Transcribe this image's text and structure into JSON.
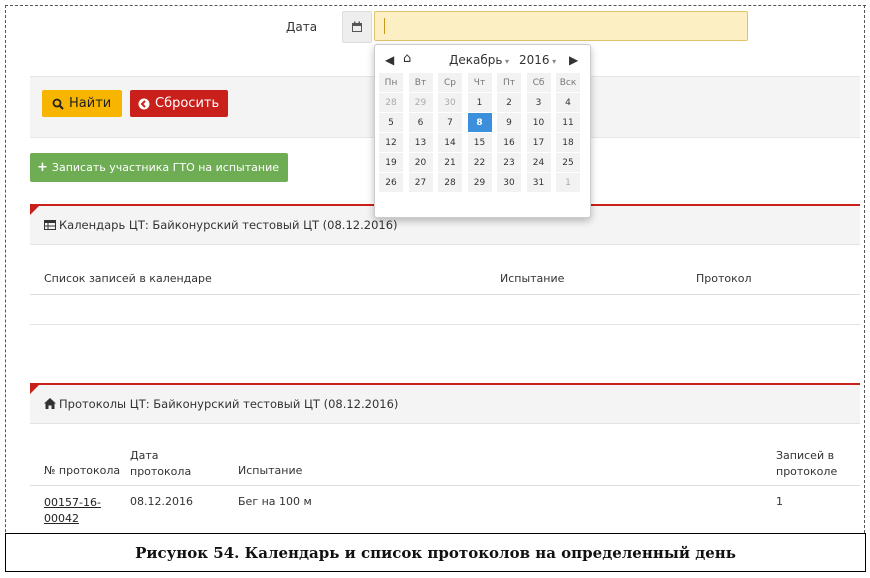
{
  "form": {
    "date_label": "Дата",
    "date_value": ""
  },
  "buttons": {
    "find": "Найти",
    "reset": "Сбросить",
    "add_participant": "Записать участника ГТО на испытание"
  },
  "datepicker": {
    "month": "Декабрь",
    "year": "2016",
    "weekdays": [
      "Пн",
      "Вт",
      "Ср",
      "Чт",
      "Пт",
      "Сб",
      "Вск"
    ],
    "weeks": [
      [
        "28",
        "29",
        "30",
        "1",
        "2",
        "3",
        "4"
      ],
      [
        "5",
        "6",
        "7",
        "8",
        "9",
        "10",
        "11"
      ],
      [
        "12",
        "13",
        "14",
        "15",
        "16",
        "17",
        "18"
      ],
      [
        "19",
        "20",
        "21",
        "22",
        "23",
        "24",
        "25"
      ],
      [
        "26",
        "27",
        "28",
        "29",
        "30",
        "31",
        "1"
      ]
    ],
    "selected": "8"
  },
  "calendar_panel": {
    "title": "Календарь ЦТ: Байконурский тестовый ЦТ (08.12.2016)",
    "columns": [
      "Список записей в календаре",
      "Испытание",
      "Протокол"
    ]
  },
  "protocols_panel": {
    "title": "Протоколы ЦТ: Байконурский тестовый ЦТ (08.12.2016)",
    "columns": {
      "number": "№ протокола",
      "date": "Дата протокола",
      "test": "Испытание",
      "records": "Записей в протоколе"
    },
    "rows": [
      {
        "number": "00157-16-00042",
        "date": "08.12.2016",
        "test": "Бег на 100 м",
        "records": "1"
      }
    ]
  },
  "caption": "Рисунок 54. Календарь и список протоколов на определенный день",
  "colors": {
    "accent_red": "#c9201b",
    "find_yellow": "#f7b500",
    "add_green": "#6fad55",
    "selected_blue": "#3b8fdb",
    "input_bg": "#fcefc4"
  }
}
